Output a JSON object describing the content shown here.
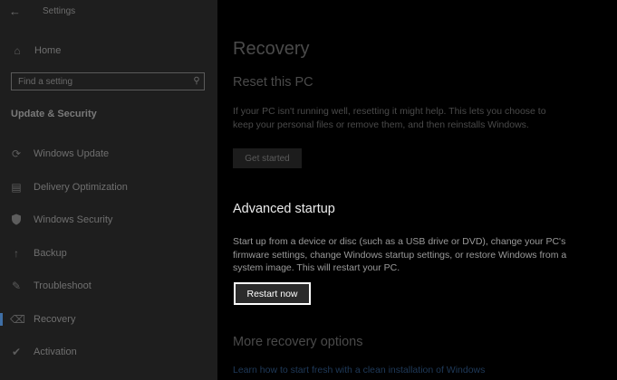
{
  "window": {
    "title": "Settings"
  },
  "sidebar": {
    "home_label": "Home",
    "search_placeholder": "Find a setting",
    "section_title": "Update & Security",
    "items": [
      {
        "label": "Windows Update",
        "icon": "sync-icon"
      },
      {
        "label": "Delivery Optimization",
        "icon": "delivery-optimization-icon"
      },
      {
        "label": "Windows Security",
        "icon": "shield-icon"
      },
      {
        "label": "Backup",
        "icon": "backup-arrow-icon"
      },
      {
        "label": "Troubleshoot",
        "icon": "wrench-icon"
      },
      {
        "label": "Recovery",
        "icon": "recovery-icon",
        "selected": true
      },
      {
        "label": "Activation",
        "icon": "activation-check-icon"
      }
    ]
  },
  "main": {
    "page_title": "Recovery",
    "reset": {
      "title": "Reset this PC",
      "description": "If your PC isn't running well, resetting it might help. This lets you choose to keep your personal files or remove them, and then reinstalls Windows.",
      "button_label": "Get started"
    },
    "advanced": {
      "title": "Advanced startup",
      "description": "Start up from a device or disc (such as a USB drive or DVD), change your PC's firmware settings, change Windows startup settings, or restore Windows from a system image. This will restart your PC.",
      "button_label": "Restart now"
    },
    "more": {
      "title": "More recovery options",
      "link": "Learn how to start fresh with a clean installation of Windows"
    }
  },
  "colors": {
    "sidebar_bg": "#1e1e1e",
    "main_bg": "#000000",
    "accent": "#3f6fa6",
    "link": "#1f3a5a"
  }
}
